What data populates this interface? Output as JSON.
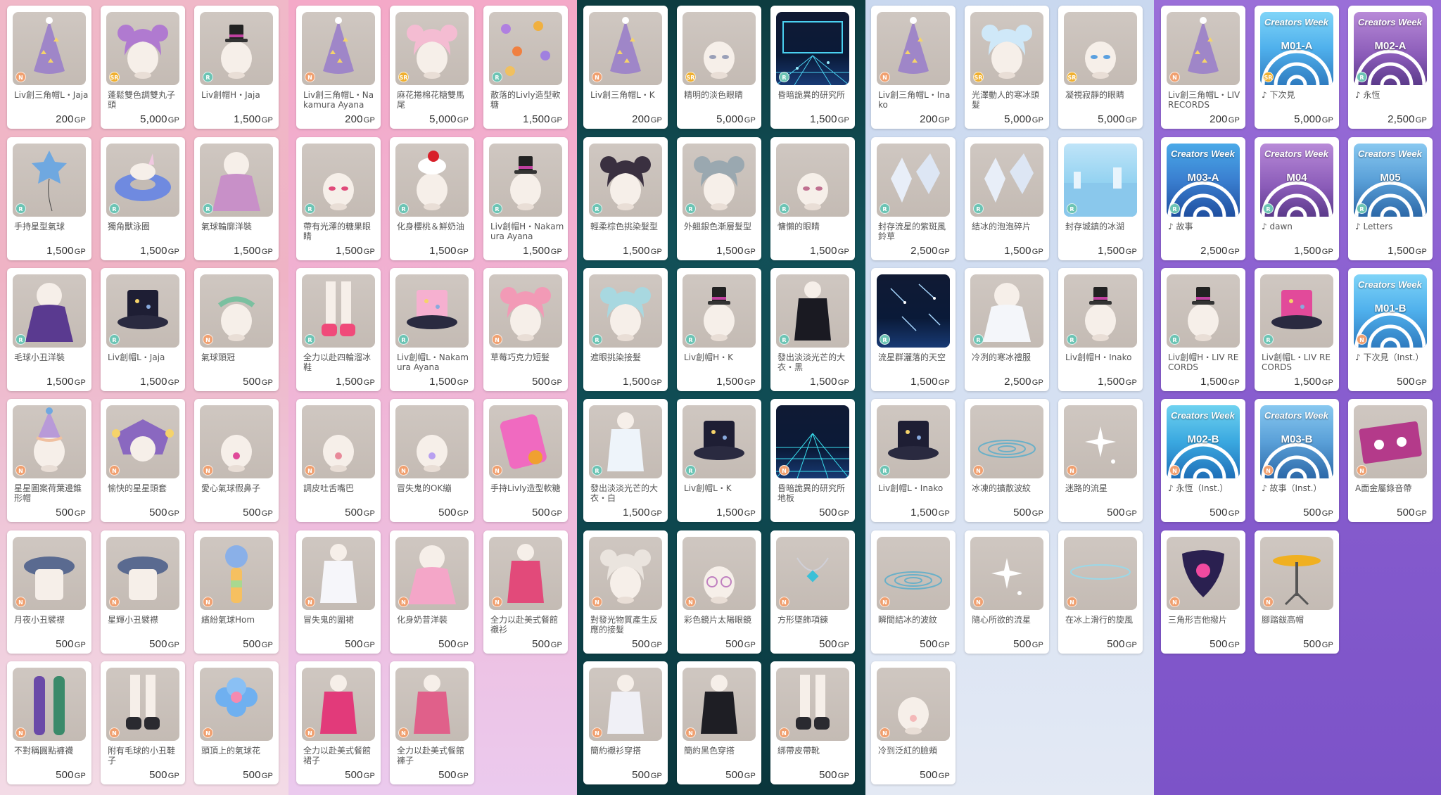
{
  "currency": "GP",
  "columns": [
    {
      "theme": "pink",
      "items": [
        {
          "name": "Liv創三角帽L・Jaja",
          "price": "200",
          "rarity": "N",
          "icon": "party-hat-icon"
        },
        {
          "name": "蓬鬆雙色調雙丸子頭",
          "price": "5,000",
          "rarity": "SR",
          "icon": "bun-hair-icon"
        },
        {
          "name": "Liv創帽H・Jaja",
          "price": "1,500",
          "rarity": "R",
          "icon": "mini-top-hat-icon"
        },
        {
          "name": "手持星型氣球",
          "price": "1,500",
          "rarity": "R",
          "icon": "star-balloon-icon"
        },
        {
          "name": "獨角獸泳圈",
          "price": "1,500",
          "rarity": "R",
          "icon": "swim-ring-icon"
        },
        {
          "name": "氣球輪廓洋裝",
          "price": "1,500",
          "rarity": "R",
          "icon": "balloon-dress-icon"
        },
        {
          "name": "毛球小丑洋裝",
          "price": "1,500",
          "rarity": "R",
          "icon": "clown-dress-icon"
        },
        {
          "name": "Liv創帽L・Jaja",
          "price": "1,500",
          "rarity": "R",
          "icon": "top-hat-icon"
        },
        {
          "name": "氣球頭冠",
          "price": "500",
          "rarity": "N",
          "icon": "balloon-crown-icon"
        },
        {
          "name": "星星圖案荷葉邊錐形帽",
          "price": "500",
          "rarity": "N",
          "icon": "cone-hat-icon"
        },
        {
          "name": "愉快的星星頭套",
          "price": "500",
          "rarity": "N",
          "icon": "jester-hood-icon"
        },
        {
          "name": "愛心氣球假鼻子",
          "price": "500",
          "rarity": "N",
          "icon": "heart-nose-icon"
        },
        {
          "name": "月夜小丑襞襟",
          "price": "500",
          "rarity": "N",
          "icon": "ruff-collar-icon"
        },
        {
          "name": "星輝小丑襞襟",
          "price": "500",
          "rarity": "N",
          "icon": "ruff-collar-icon"
        },
        {
          "name": "繽紛氣球Hom",
          "price": "500",
          "rarity": "N",
          "icon": "balloon-horn-icon"
        },
        {
          "name": "不對稱圓點褲襪",
          "price": "500",
          "rarity": "N",
          "icon": "tights-icon"
        },
        {
          "name": "附有毛球的小丑鞋子",
          "price": "500",
          "rarity": "N",
          "icon": "clown-shoes-icon"
        },
        {
          "name": "頭頂上的氣球花",
          "price": "500",
          "rarity": "N",
          "icon": "balloon-flower-icon"
        }
      ]
    },
    {
      "theme": "pink-lavender",
      "items": [
        {
          "name": "Liv創三角帽L・Nakamura Ayana",
          "price": "200",
          "rarity": "N",
          "icon": "party-hat-icon"
        },
        {
          "name": "麻花捲棉花糖雙馬尾",
          "price": "5,000",
          "rarity": "SR",
          "icon": "twin-tail-hair-icon"
        },
        {
          "name": "散落的Livly造型軟糖",
          "price": "1,500",
          "rarity": "R",
          "icon": "gummy-icon"
        },
        {
          "name": "帶有光澤的糖果眼睛",
          "price": "1,500",
          "rarity": "R",
          "icon": "candy-eyes-icon"
        },
        {
          "name": "化身櫻桃＆鮮奶油",
          "price": "1,500",
          "rarity": "R",
          "icon": "cherry-cream-icon"
        },
        {
          "name": "Liv創帽H・Nakamura Ayana",
          "price": "1,500",
          "rarity": "R",
          "icon": "mini-hat-icon"
        },
        {
          "name": "全力以赴四輪溜冰鞋",
          "price": "1,500",
          "rarity": "R",
          "icon": "roller-skates-icon"
        },
        {
          "name": "Liv創帽L・Nakamura Ayana",
          "price": "1,500",
          "rarity": "R",
          "icon": "cake-hat-icon"
        },
        {
          "name": "草莓巧克力短髮",
          "price": "500",
          "rarity": "N",
          "icon": "short-hair-icon"
        },
        {
          "name": "調皮吐舌嘴巴",
          "price": "500",
          "rarity": "N",
          "icon": "tongue-mouth-icon"
        },
        {
          "name": "冒失鬼的OK繃",
          "price": "500",
          "rarity": "N",
          "icon": "bandage-icon"
        },
        {
          "name": "手持Livly造型軟糖",
          "price": "500",
          "rarity": "N",
          "icon": "gummy-bag-icon"
        },
        {
          "name": "冒失鬼的圍裙",
          "price": "500",
          "rarity": "N",
          "icon": "apron-icon"
        },
        {
          "name": "化身奶昔洋裝",
          "price": "500",
          "rarity": "N",
          "icon": "shake-dress-icon"
        },
        {
          "name": "全力以赴美式餐館襯衫",
          "price": "500",
          "rarity": "N",
          "icon": "diner-shirt-icon"
        },
        {
          "name": "全力以赴美式餐館裙子",
          "price": "500",
          "rarity": "N",
          "icon": "diner-skirt-icon"
        },
        {
          "name": "全力以赴美式餐館褲子",
          "price": "500",
          "rarity": "N",
          "icon": "diner-pants-icon"
        }
      ]
    },
    {
      "theme": "teal",
      "items": [
        {
          "name": "Liv創三角帽L・K",
          "price": "200",
          "rarity": "N",
          "icon": "party-hat-icon"
        },
        {
          "name": "精明的淡色眼睛",
          "price": "5,000",
          "rarity": "SR",
          "icon": "eyes-icon"
        },
        {
          "name": "昏暗詭異的研究所",
          "price": "1,500",
          "rarity": "R",
          "icon": "lab-background-icon"
        },
        {
          "name": "輕柔棕色挑染髮型",
          "price": "1,500",
          "rarity": "R",
          "icon": "streak-hair-icon"
        },
        {
          "name": "外翹銀色漸層髮型",
          "price": "1,500",
          "rarity": "R",
          "icon": "silver-hair-icon"
        },
        {
          "name": "慵懶的眼睛",
          "price": "1,500",
          "rarity": "R",
          "icon": "lazy-eyes-icon"
        },
        {
          "name": "遮眼挑染接髮",
          "price": "1,500",
          "rarity": "R",
          "icon": "hair-extension-icon"
        },
        {
          "name": "Liv創帽H・K",
          "price": "1,500",
          "rarity": "R",
          "icon": "mini-top-hat-icon"
        },
        {
          "name": "發出淡淡光芒的大衣・黑",
          "price": "1,500",
          "rarity": "R",
          "icon": "black-coat-icon"
        },
        {
          "name": "發出淡淡光芒的大衣・白",
          "price": "1,500",
          "rarity": "R",
          "icon": "white-coat-icon"
        },
        {
          "name": "Liv創帽L・K",
          "price": "1,500",
          "rarity": "R",
          "icon": "top-hat-icon"
        },
        {
          "name": "昏暗詭異的研究所地板",
          "price": "500",
          "rarity": "N",
          "icon": "grid-floor-icon"
        },
        {
          "name": "對發光物質產生反應的接髮",
          "price": "500",
          "rarity": "N",
          "icon": "glow-hair-icon"
        },
        {
          "name": "彩色鏡片太陽眼鏡",
          "price": "500",
          "rarity": "N",
          "icon": "sunglasses-icon"
        },
        {
          "name": "方形墜飾項鍊",
          "price": "500",
          "rarity": "N",
          "icon": "necklace-icon"
        },
        {
          "name": "簡約襯衫穿搭",
          "price": "500",
          "rarity": "N",
          "icon": "shirt-outfit-icon"
        },
        {
          "name": "簡約黑色穿搭",
          "price": "500",
          "rarity": "N",
          "icon": "black-outfit-icon"
        },
        {
          "name": "綁帶皮帶靴",
          "price": "500",
          "rarity": "N",
          "icon": "boots-icon"
        }
      ]
    },
    {
      "theme": "ice",
      "items": [
        {
          "name": "Liv創三角帽L・Inako",
          "price": "200",
          "rarity": "N",
          "icon": "party-hat-icon"
        },
        {
          "name": "光澤動人的寒冰頭髮",
          "price": "5,000",
          "rarity": "SR",
          "icon": "ice-hair-icon"
        },
        {
          "name": "凝視寂靜的眼睛",
          "price": "5,000",
          "rarity": "SR",
          "icon": "blue-eyes-icon"
        },
        {
          "name": "封存流星的紫斑風鈴草",
          "price": "2,500",
          "rarity": "R",
          "icon": "crystal-flower-icon"
        },
        {
          "name": "結冰的泡泡碎片",
          "price": "1,500",
          "rarity": "R",
          "icon": "bubble-shard-icon"
        },
        {
          "name": "封存城鎮的冰湖",
          "price": "1,500",
          "rarity": "R",
          "icon": "ice-lake-icon"
        },
        {
          "name": "流星群灑落的天空",
          "price": "1,500",
          "rarity": "R",
          "icon": "meteor-sky-icon"
        },
        {
          "name": "冷冽的寒冰禮服",
          "price": "2,500",
          "rarity": "R",
          "icon": "ice-gown-icon"
        },
        {
          "name": "Liv創帽H・Inako",
          "price": "1,500",
          "rarity": "R",
          "icon": "mini-hat-icon"
        },
        {
          "name": "Liv創帽L・Inako",
          "price": "1,500",
          "rarity": "R",
          "icon": "top-hat-icon"
        },
        {
          "name": "冰凍的擴散波紋",
          "price": "500",
          "rarity": "N",
          "icon": "ripple-icon"
        },
        {
          "name": "迷路的流星",
          "price": "500",
          "rarity": "N",
          "icon": "sparkle-icon"
        },
        {
          "name": "瞬間結冰的波紋",
          "price": "500",
          "rarity": "N",
          "icon": "ripple-icon"
        },
        {
          "name": "隨心所欲的流星",
          "price": "500",
          "rarity": "N",
          "icon": "sparkle-icon"
        },
        {
          "name": "在冰上滑行的旋風",
          "price": "500",
          "rarity": "N",
          "icon": "whirl-icon"
        },
        {
          "name": "冷到泛紅的臉頰",
          "price": "500",
          "rarity": "N",
          "icon": "blush-icon"
        }
      ]
    },
    {
      "theme": "purple",
      "items": [
        {
          "name": "Liv創三角帽L・LIV RECORDS",
          "price": "200",
          "rarity": "N",
          "icon": "party-hat-icon"
        },
        {
          "name": "♪ 下次見",
          "price": "5,000",
          "rarity": "SR",
          "icon": "music-cover-icon",
          "cover": "M01-A"
        },
        {
          "name": "♪ 永恆",
          "price": "2,500",
          "rarity": "R",
          "icon": "music-cover-icon",
          "cover": "M02-A"
        },
        {
          "name": "♪ 故事",
          "price": "2,500",
          "rarity": "R",
          "icon": "music-cover-icon",
          "cover": "M03-A"
        },
        {
          "name": "♪ dawn",
          "price": "1,500",
          "rarity": "R",
          "icon": "music-cover-icon",
          "cover": "M04"
        },
        {
          "name": "♪ Letters",
          "price": "1,500",
          "rarity": "R",
          "icon": "music-cover-icon",
          "cover": "M05"
        },
        {
          "name": "Liv創帽H・LIV RECORDS",
          "price": "1,500",
          "rarity": "R",
          "icon": "mini-hat-icon"
        },
        {
          "name": "Liv創帽L・LIV RECORDS",
          "price": "1,500",
          "rarity": "R",
          "icon": "drum-hat-icon"
        },
        {
          "name": "♪ 下次見（Inst.）",
          "price": "500",
          "rarity": "N",
          "icon": "music-cover-icon",
          "cover": "M01-B"
        },
        {
          "name": "♪ 永恆（Inst.）",
          "price": "500",
          "rarity": "N",
          "icon": "music-cover-icon",
          "cover": "M02-B"
        },
        {
          "name": "♪ 故事（Inst.）",
          "price": "500",
          "rarity": "N",
          "icon": "music-cover-icon",
          "cover": "M03-B"
        },
        {
          "name": "A面金屬錄音帶",
          "price": "500",
          "rarity": "N",
          "icon": "cassette-icon"
        },
        {
          "name": "三角形吉他撥片",
          "price": "500",
          "rarity": "N",
          "icon": "guitar-pick-icon"
        },
        {
          "name": "腳踏鈸高帽",
          "price": "500",
          "rarity": "N",
          "icon": "hihat-icon"
        }
      ]
    }
  ],
  "cover_brand": "Creators Week",
  "pick_brand": "LIV RECORDS"
}
